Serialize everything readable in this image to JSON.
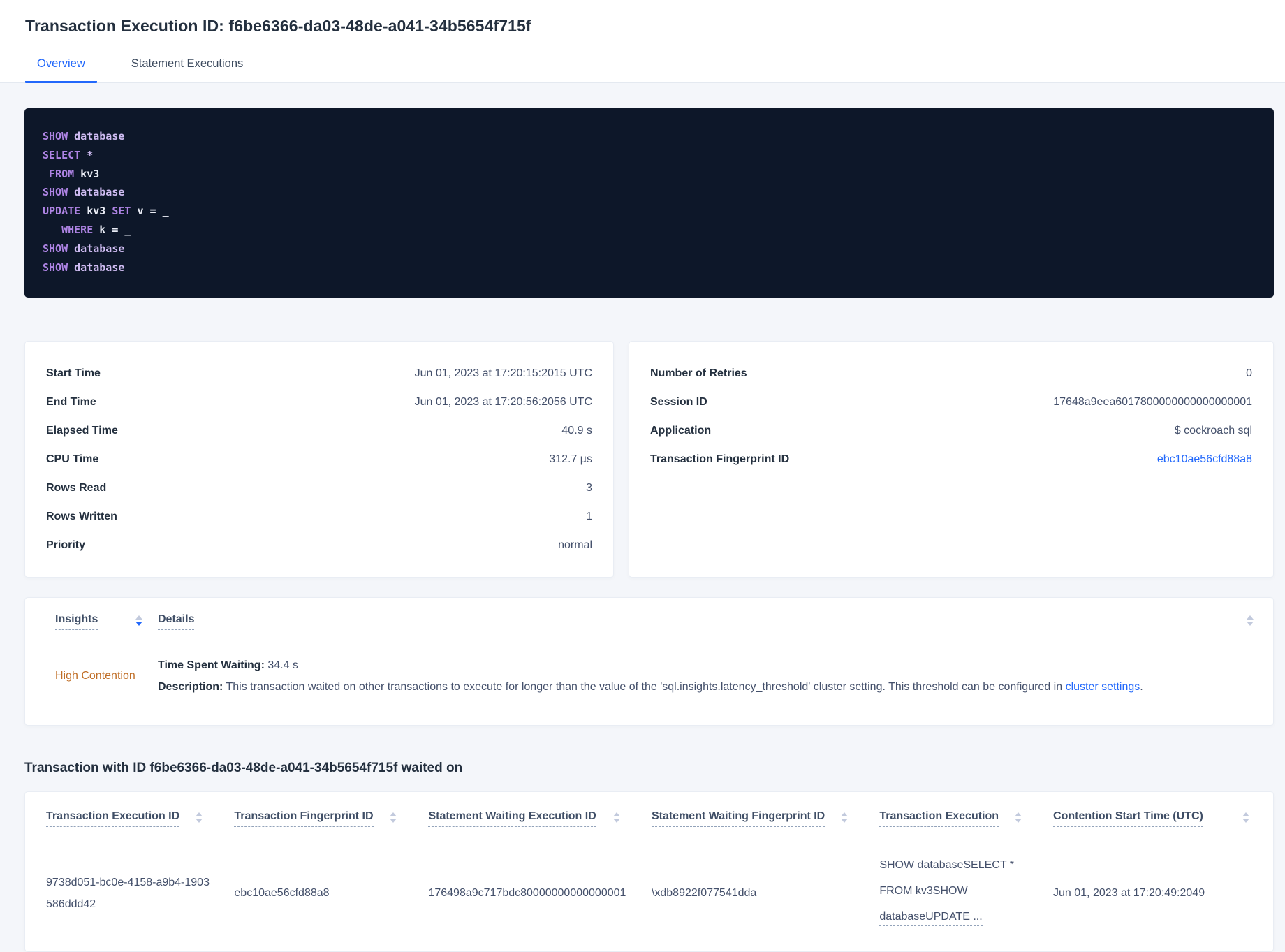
{
  "page": {
    "title": "Transaction Execution ID: f6be6366-da03-48de-a041-34b5654f715f"
  },
  "tabs": [
    {
      "label": "Overview",
      "active": true
    },
    {
      "label": "Statement Executions",
      "active": false
    }
  ],
  "sql_box": {
    "lines": [
      {
        "tokens": [
          [
            "kw",
            "SHOW"
          ],
          [
            "ident",
            " database"
          ]
        ]
      },
      {
        "tokens": [
          [
            "kw",
            "SELECT"
          ],
          [
            "ident",
            " *"
          ]
        ]
      },
      {
        "tokens": [
          [
            "plain",
            " "
          ],
          [
            "kw",
            "FROM"
          ],
          [
            "plain",
            " kv3"
          ]
        ]
      },
      {
        "tokens": [
          [
            "kw",
            "SHOW"
          ],
          [
            "ident",
            " database"
          ]
        ]
      },
      {
        "tokens": [
          [
            "kw",
            "UPDATE"
          ],
          [
            "plain",
            " kv3 "
          ],
          [
            "kw",
            "SET"
          ],
          [
            "plain",
            " v = _"
          ]
        ]
      },
      {
        "tokens": [
          [
            "plain",
            "   "
          ],
          [
            "kw",
            "WHERE"
          ],
          [
            "plain",
            " k = _"
          ]
        ]
      },
      {
        "tokens": [
          [
            "kw",
            "SHOW"
          ],
          [
            "ident",
            " database"
          ]
        ]
      },
      {
        "tokens": [
          [
            "kw",
            "SHOW"
          ],
          [
            "ident",
            " database"
          ]
        ]
      }
    ]
  },
  "summary_left": {
    "rows": [
      {
        "label": "Start Time",
        "value": "Jun 01, 2023 at 17:20:15:2015 UTC"
      },
      {
        "label": "End Time",
        "value": "Jun 01, 2023 at 17:20:56:2056 UTC"
      },
      {
        "label": "Elapsed Time",
        "value": "40.9 s"
      },
      {
        "label": "CPU Time",
        "value": "312.7 µs"
      },
      {
        "label": "Rows Read",
        "value": "3"
      },
      {
        "label": "Rows Written",
        "value": "1"
      },
      {
        "label": "Priority",
        "value": "normal"
      }
    ]
  },
  "summary_right": {
    "rows": [
      {
        "label": "Number of Retries",
        "value": "0"
      },
      {
        "label": "Session ID",
        "value": "17648a9eea6017800000000000000001"
      },
      {
        "label": "Application",
        "value": "$ cockroach sql"
      },
      {
        "label": "Transaction Fingerprint ID",
        "value": "ebc10ae56cfd88a8",
        "link": true
      }
    ]
  },
  "insights_table": {
    "columns": [
      {
        "label": "Insights",
        "sorted": "desc"
      },
      {
        "label": "Details",
        "sorted": null
      }
    ],
    "row": {
      "insight": "High Contention",
      "waiting_label": "Time Spent Waiting:",
      "waiting_value": " 34.4 s",
      "description_label": "Description:",
      "description_text": " This transaction waited on other transactions to execute for longer than the value of the 'sql.insights.latency_threshold' cluster setting. This threshold can be configured in ",
      "description_link": "cluster settings",
      "description_suffix": "."
    }
  },
  "waited_on": {
    "heading": "Transaction with ID f6be6366-da03-48de-a041-34b5654f715f waited on",
    "columns": [
      "Transaction Execution ID",
      "Transaction Fingerprint ID",
      "Statement Waiting Execution ID",
      "Statement Waiting Fingerprint ID",
      "Transaction Execution",
      "Contention Start Time (UTC)"
    ],
    "row": {
      "transaction_execution_id": "9738d051-bc0e-4158-a9b4-1903586ddd42",
      "transaction_fingerprint_id": "ebc10ae56cfd88a8",
      "statement_waiting_execution_id": "176498a9c717bdc80000000000000001",
      "statement_waiting_fingerprint_id": "\\xdb8922f077541dda",
      "transaction_execution_lines": [
        "SHOW databaseSELECT *",
        "FROM kv3SHOW",
        "databaseUPDATE ..."
      ],
      "contention_start_time": "Jun 01, 2023 at 17:20:49:2049"
    }
  },
  "colors": {
    "accent_blue": "#2268fb",
    "insight_warning_orange": "#c06e26",
    "sql_background_navy": "#0d1729",
    "sql_keyword_purple": "#ae84e4",
    "sql_identifier_lavender": "#cfbcf2",
    "page_background": "#f4f6fa"
  },
  "icons": {
    "sort": "sort-arrows-icon"
  }
}
